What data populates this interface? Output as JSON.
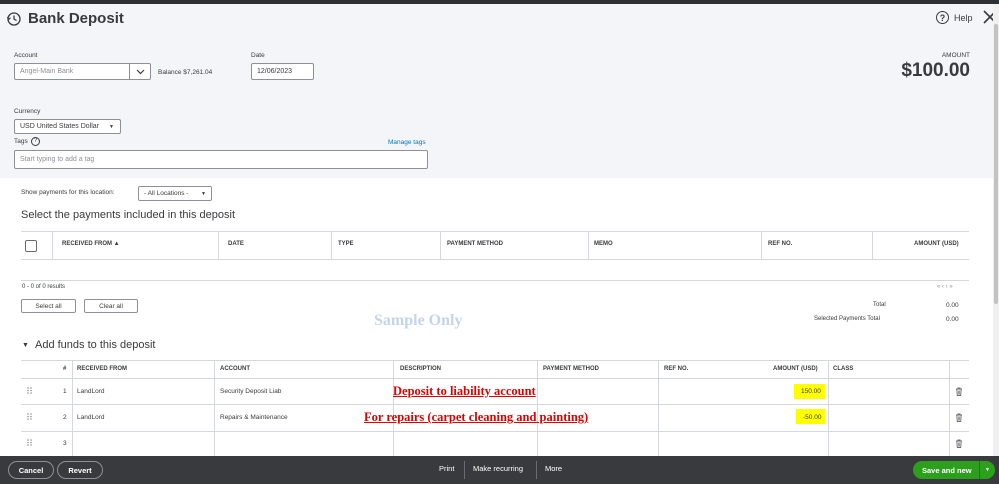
{
  "window": {
    "title": "Bank Deposit",
    "help_label": "Help"
  },
  "header": {
    "account_label": "Account",
    "account_value": "Angel-Main Bank",
    "balance_text": "Balance $7,261.04",
    "date_label": "Date",
    "date_value": "12/06/2023",
    "amount_label": "AMOUNT",
    "amount_value": "$100.00",
    "currency_label": "Currency",
    "currency_value": "USD United States Dollar",
    "tags_label": "Tags",
    "manage_tags": "Manage tags",
    "tags_placeholder": "Start typing to add a tag"
  },
  "payments": {
    "location_label": "Show payments for this location:",
    "location_value": "- All Locations -",
    "section_title": "Select the payments included in this deposit",
    "columns": [
      "RECEIVED FROM ▲",
      "DATE",
      "TYPE",
      "PAYMENT METHOD",
      "MEMO",
      "REF NO.",
      "AMOUNT (USD)"
    ],
    "results_text": "0 - 0 of 0 results",
    "pager_text": "« ‹ › »",
    "select_all": "Select all",
    "clear_all": "Clear all",
    "total_label": "Total",
    "total_value": "0.00",
    "selected_total_label": "Selected Payments Total",
    "selected_total_value": "0.00"
  },
  "watermark": "Sample Only",
  "funds": {
    "section_title": "Add funds to this deposit",
    "columns": [
      "#",
      "RECEIVED FROM",
      "ACCOUNT",
      "DESCRIPTION",
      "PAYMENT METHOD",
      "REF NO.",
      "AMOUNT (USD)",
      "CLASS"
    ],
    "rows": [
      {
        "num": "1",
        "received_from": "LandLord",
        "account": "Security Deposit Liab",
        "amount": "150.00"
      },
      {
        "num": "2",
        "received_from": "LandLord",
        "account": "Repairs & Maintenance",
        "amount": "-50.00"
      },
      {
        "num": "3",
        "received_from": "",
        "account": "",
        "amount": ""
      }
    ],
    "annotations": [
      "Deposit to liability account",
      "For repairs (carpet cleaning and painting)"
    ]
  },
  "footer": {
    "cancel": "Cancel",
    "revert": "Revert",
    "print": "Print",
    "make_recurring": "Make recurring",
    "more": "More",
    "save_new": "Save and new"
  },
  "colors": {
    "accent_green": "#2ca01c",
    "annotation_red": "#e00000",
    "highlight": "#ffff00",
    "link_blue": "#0077c5"
  }
}
